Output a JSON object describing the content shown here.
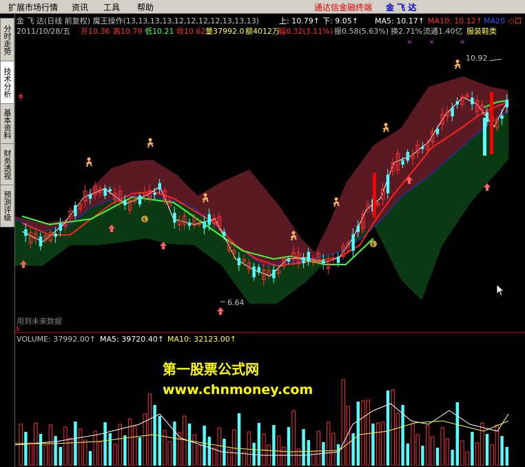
{
  "menu": {
    "items": [
      "扩展市场行情",
      "资讯",
      "工具",
      "帮助"
    ],
    "terminal_title": "通达信金融终端",
    "stock_title": "金 飞 达"
  },
  "sidebar": {
    "tabs": [
      "分时走势",
      "技术分析",
      "基本资料",
      "财务透视",
      "预测评级"
    ]
  },
  "price_panel": {
    "title": "金 飞 达(日线 前复权) 魔王操作(13,13,13,13,12,12,12,12,13,13,13)",
    "upper_label": "上: 10.79↑",
    "lower_label": "下: 9.05↑",
    "ma5_label": "MA5: 10.17↑",
    "ma10_label": "MA10: 10.12↑",
    "ma20_label": "MA20",
    "diamond_label": "◇口",
    "date": "2011/10/28/五",
    "open": "开10.36",
    "high": "高10.79",
    "low": "低10.21",
    "close": "收10.62",
    "volume": "量37992.0",
    "amount": "额4012万",
    "change": "幅0.32(3.11%)",
    "amplitude": "振0.58(5.63%)",
    "turnover": "换2.71%",
    "float_shares": "流通1.40亿",
    "sector": "服装鞋类",
    "high_marker": "10.92",
    "low_marker": "6.64",
    "future_data_note": "用到未来数据",
    "warning_glyph": "$",
    "colors": {
      "up": "#ff3232",
      "down": "#54ffff",
      "upper_band": "#5a1a24",
      "lower_band": "#0a3a12"
    }
  },
  "volume_panel": {
    "volume_label": "VOLUME: 37992.00↑",
    "ma5_label": "MA5: 39720.40↑",
    "ma10_label": "MA10: 32123.00↑"
  },
  "watermark": {
    "line1": "第一股票公式网",
    "line2": "www.chnmoney.com"
  }
}
